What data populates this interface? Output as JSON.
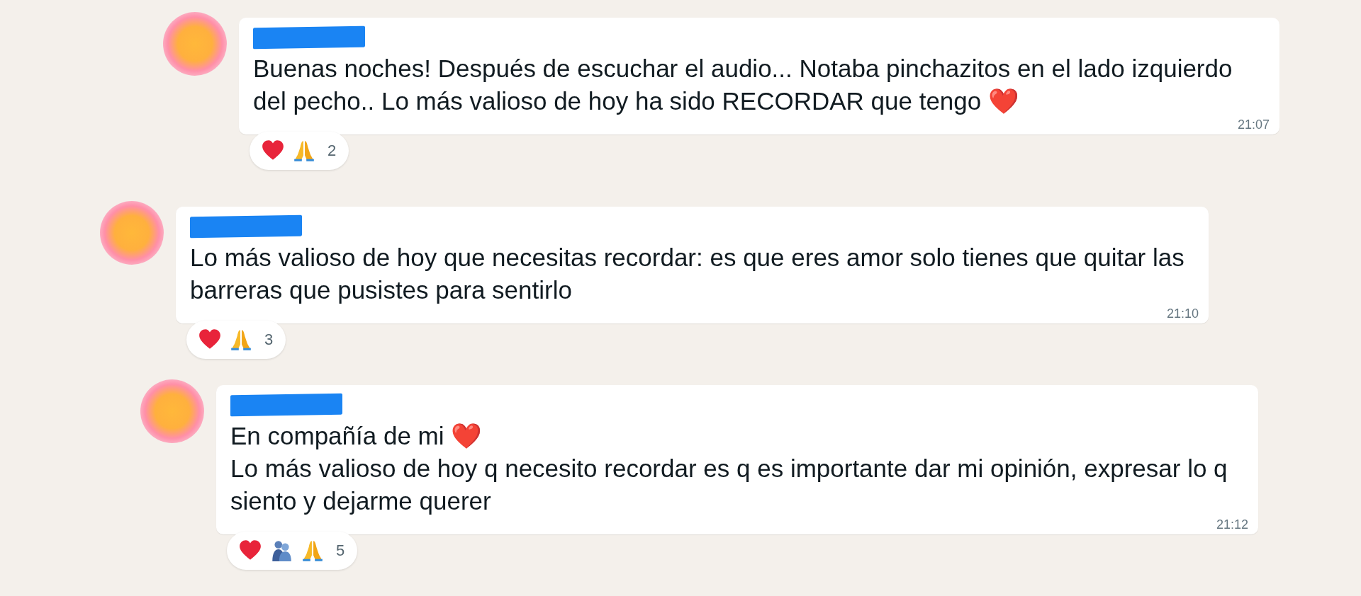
{
  "messages": [
    {
      "paragraphs": [
        {
          "text": "Buenas noches! Después de escuchar el audio... Notaba pinchazitos en el lado izquierdo del pecho.. Lo más valioso de hoy ha sido RECORDAR que tengo",
          "trailing_emoji": "❤️"
        }
      ],
      "time": "21:07",
      "reactions": {
        "icons": [
          {
            "kind": "heart"
          },
          {
            "kind": "praying-hands"
          }
        ],
        "count": "2"
      }
    },
    {
      "paragraphs": [
        {
          "text": "Lo más valioso de hoy que necesitas recordar: es que eres amor solo tienes que quitar las barreras que pusistes para sentirlo"
        }
      ],
      "time": "21:10",
      "reactions": {
        "icons": [
          {
            "kind": "heart"
          },
          {
            "kind": "praying-hands"
          }
        ],
        "count": "3"
      }
    },
    {
      "paragraphs": [
        {
          "text": "En compañía de mi",
          "trailing_emoji": "❤️"
        },
        {
          "text": "Lo más valioso de hoy q necesito recordar es q es importante dar mi opinión, expresar lo q siento y dejarme querer"
        }
      ],
      "time": "21:12",
      "reactions": {
        "icons": [
          {
            "kind": "heart"
          },
          {
            "kind": "hugging-people"
          },
          {
            "kind": "praying-hands"
          }
        ],
        "count": "5"
      }
    }
  ]
}
